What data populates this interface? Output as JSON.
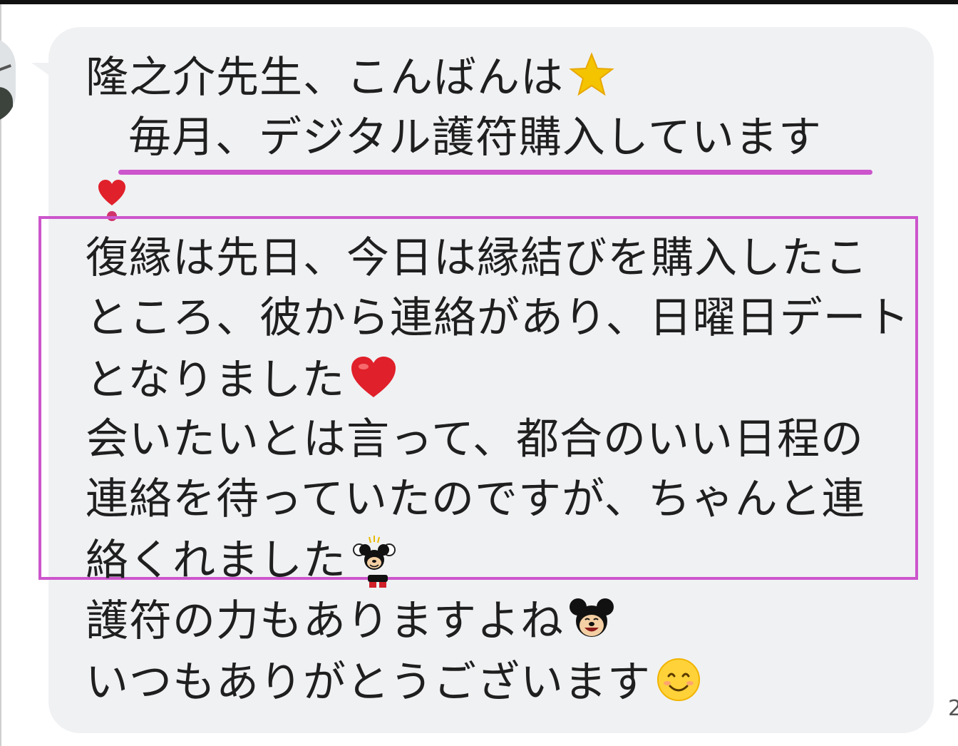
{
  "message": {
    "lines": [
      "隆之介先生、こんばんは",
      "毎月、デジタル護符購入しています",
      "復縁は先日、今日は縁結びを購入したこ",
      "ところ、彼から連絡があり、日曜日デート",
      "となりました",
      "会いたいとは言って、都合のいい日程の",
      "連絡を待っていたのですが、ちゃんと連",
      "絡くれました",
      "護符の力もありますよね",
      "いつもありがとうございます"
    ],
    "emojis": {
      "line0": "star-emoji",
      "line4": "red-heart-emoji",
      "line7": "mickey-cheering-emoji",
      "line8": "mickey-smiling-emoji",
      "line9": "smiling-face-emoji",
      "marker": "small-red-heart-emoji"
    }
  },
  "timestamp": "2",
  "colors": {
    "bubble": "#f0f1f3",
    "highlight": "#cc55cc",
    "text": "#1f1f1f",
    "heart": "#e0202a",
    "star": "#f5c400"
  }
}
